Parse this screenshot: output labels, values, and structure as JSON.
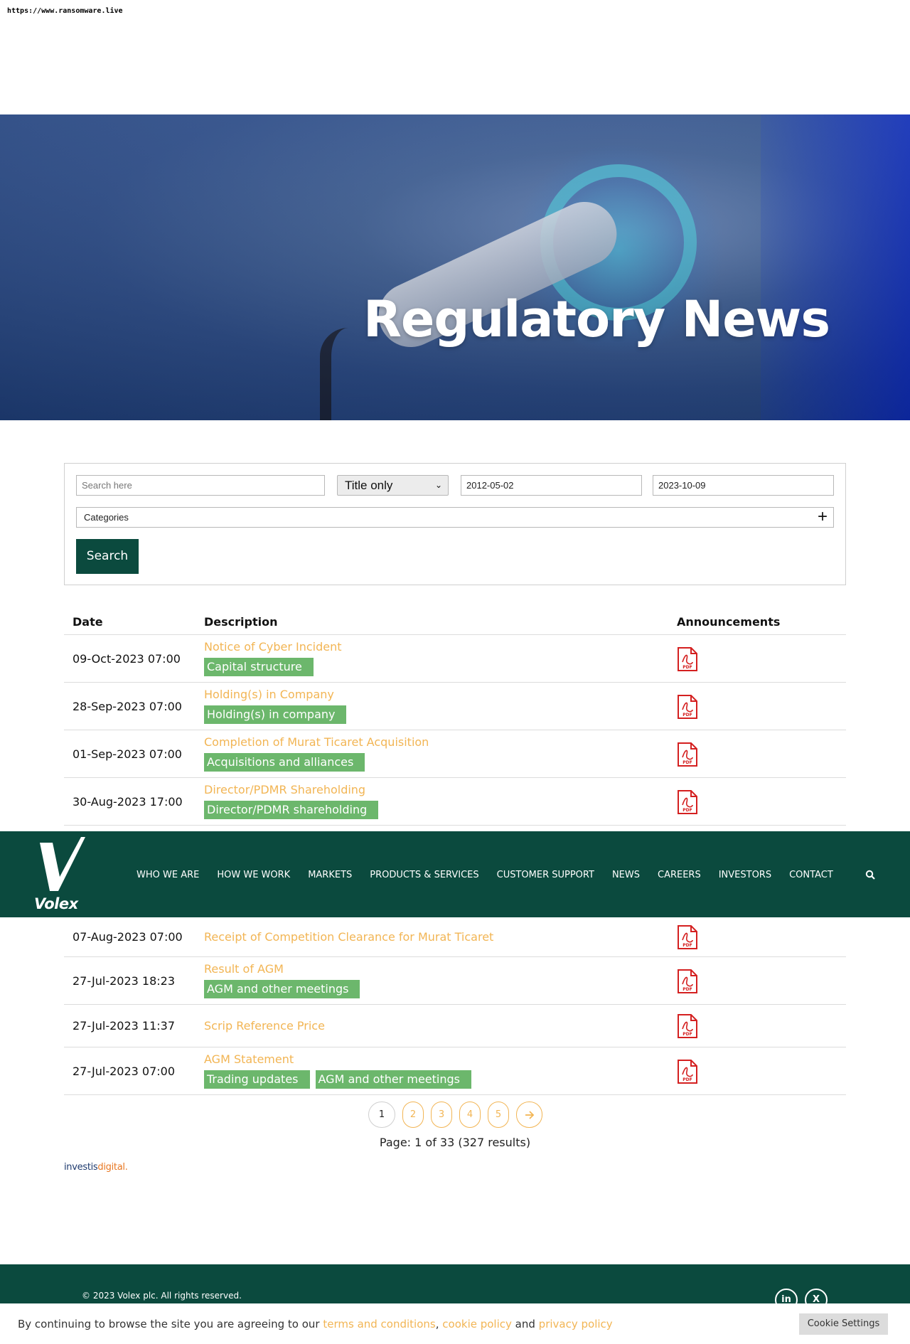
{
  "source_url": "https://www.ransomware.live",
  "hero": {
    "title": "Regulatory News"
  },
  "search": {
    "placeholder": "Search here",
    "scope_selected": "Title only",
    "date_from": "2012-05-02",
    "date_to": "2023-10-09",
    "categories_label": "Categories",
    "button_label": "Search"
  },
  "table": {
    "headers": {
      "date": "Date",
      "description": "Description",
      "announcements": "Announcements"
    },
    "rows": [
      {
        "date": "09-Oct-2023 07:00",
        "title": "Notice of Cyber Incident",
        "tags": [
          "Capital structure"
        ]
      },
      {
        "date": "28-Sep-2023 07:00",
        "title": "Holding(s) in Company",
        "tags": [
          "Holding(s) in company"
        ]
      },
      {
        "date": "01-Sep-2023 07:00",
        "title": "Completion of Murat Ticaret Acquisition",
        "tags": [
          "Acquisitions and alliances"
        ]
      },
      {
        "date": "30-Aug-2023 17:00",
        "title": "Director/PDMR Shareholding",
        "tags": [
          "Director/PDMR shareholding"
        ]
      },
      {
        "date": "07-Aug-2023 07:00",
        "title": "Receipt of Competition Clearance for Murat Ticaret",
        "tags": []
      },
      {
        "date": "27-Jul-2023 18:23",
        "title": "Result of AGM",
        "tags": [
          "AGM and other meetings"
        ]
      },
      {
        "date": "27-Jul-2023 11:37",
        "title": "Scrip Reference Price",
        "tags": []
      },
      {
        "date": "27-Jul-2023 07:00",
        "title": "AGM Statement",
        "tags": [
          "Trading updates",
          "AGM and other meetings"
        ]
      }
    ],
    "pdf_icon": "pdf-icon"
  },
  "nav": {
    "logo_text": "Volex",
    "items": [
      "WHO WE ARE",
      "HOW WE WORK",
      "MARKETS",
      "PRODUCTS & SERVICES",
      "CUSTOMER SUPPORT",
      "NEWS",
      "CAREERS",
      "INVESTORS",
      "CONTACT"
    ],
    "search_icon": "search-icon"
  },
  "pagination": {
    "current": "1",
    "pages": [
      "2",
      "3",
      "4",
      "5"
    ],
    "next_icon": "arrow-right-icon",
    "info": "Page: 1 of 33 (327 results)"
  },
  "branding": {
    "investis_part1": "investis",
    "investis_part2": "digital."
  },
  "footer": {
    "copyright": "© 2023 Volex plc. All rights reserved.",
    "social": [
      "in",
      "X"
    ]
  },
  "cookie": {
    "text1": "By continuing to browse the site you are agreeing to our ",
    "link1": "terms and conditions",
    "sep1": ", ",
    "link2": "cookie policy",
    "sep2": " and ",
    "link3": "privacy policy",
    "button": "Cookie Settings"
  },
  "colors": {
    "brand_green": "#0b4a3e",
    "link_orange": "#f2b554",
    "tag_green": "#6cb76c",
    "pdf_red": "#d42020"
  }
}
